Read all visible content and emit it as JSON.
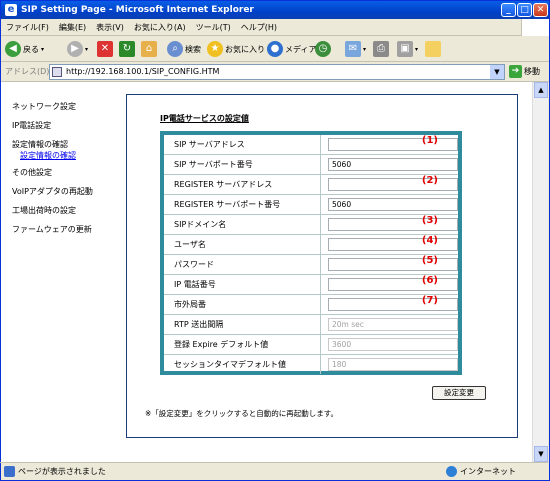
{
  "window": {
    "title": "SIP Setting Page - Microsoft Internet Explorer"
  },
  "menu": [
    "ファイル(F)",
    "編集(E)",
    "表示(V)",
    "お気に入り(A)",
    "ツール(T)",
    "ヘルプ(H)"
  ],
  "toolbar": {
    "back": "戻る",
    "search": "検索",
    "favorites": "お気に入り",
    "media": "メディア"
  },
  "address": {
    "label": "アドレス(D)",
    "url": "http://192.168.100.1/SIP_CONFIG.HTM",
    "go": "移動"
  },
  "nav": {
    "items": [
      "ネットワーク設定",
      "IP電話設定",
      "設定情報の確認"
    ],
    "sub": "設定情報の確認",
    "items2": [
      "その他設定",
      "VoIPアダプタの再起動",
      "工場出荷時の設定",
      "ファームウェアの更新"
    ]
  },
  "page": {
    "title": "IP電話サービスの設定値",
    "rows": [
      {
        "label": "SIP サーバアドレス",
        "value": "",
        "mark": "(1)"
      },
      {
        "label": "SIP サーバポート番号",
        "value": "5060",
        "mark": ""
      },
      {
        "label": "REGISTER サーバアドレス",
        "value": "",
        "mark": "(2)"
      },
      {
        "label": "REGISTER サーバポート番号",
        "value": "5060",
        "mark": ""
      },
      {
        "label": "SIPドメイン名",
        "value": "",
        "mark": "(3)"
      },
      {
        "label": "ユーザ名",
        "value": "",
        "mark": "(4)"
      },
      {
        "label": "パスワード",
        "value": "",
        "mark": "(5)"
      },
      {
        "label": "IP 電話番号",
        "value": "",
        "mark": "(6)"
      },
      {
        "label": "市外局番",
        "value": "",
        "mark": "(7)"
      },
      {
        "label": "RTP 送出間隔",
        "value": "20m sec",
        "mark": ""
      },
      {
        "label": "登録 Expire デフォルト値",
        "value": "3600",
        "mark": ""
      },
      {
        "label": "セッションタイマデフォルト値",
        "value": "180",
        "mark": ""
      }
    ],
    "submit": "設定変更",
    "note": "※「設定変更」をクリックすると自動的に再起動します。"
  },
  "status": {
    "left": "ページが表示されました",
    "zone": "インターネット"
  }
}
